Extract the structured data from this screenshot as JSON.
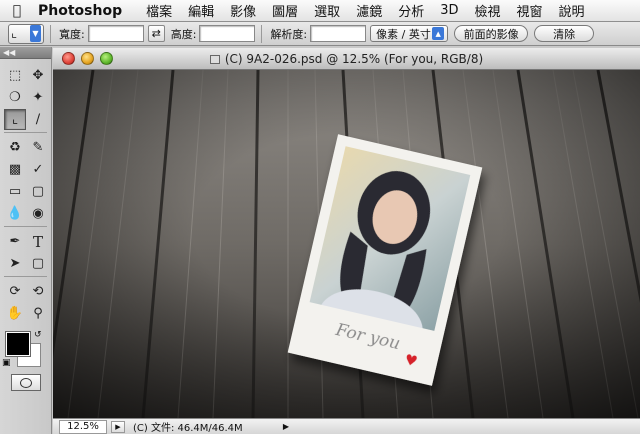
{
  "menubar": {
    "app_name": "Photoshop",
    "items": [
      "檔案",
      "編輯",
      "影像",
      "圖層",
      "選取",
      "濾鏡",
      "分析",
      "3D",
      "檢視",
      "視窗",
      "說明"
    ]
  },
  "options_bar": {
    "width_label": "寬度:",
    "height_label": "高度:",
    "resolution_label": "解析度:",
    "unit_select": "像素 / 英寸",
    "front_image_button": "前面的影像",
    "clear_button": "清除"
  },
  "document": {
    "title": "(C) 9A2-026.psd @ 12.5% (For you, RGB/8)",
    "zoom": "12.5%",
    "file_info": "(C) 文件: 46.4M/46.4M",
    "photo_caption": "For you"
  },
  "colors": {
    "foreground": "#000000",
    "background": "#ffffff",
    "accent": "#3b78d8"
  },
  "icons": {
    "tools": [
      "marquee",
      "move",
      "lasso",
      "quick-selection",
      "crop",
      "eyedropper",
      "spot-healing",
      "brush",
      "clone-stamp",
      "history-brush",
      "eraser",
      "gradient",
      "blur",
      "dodge",
      "pen",
      "type",
      "path-selection",
      "shape",
      "3d-rotate",
      "3d-orbit",
      "hand",
      "zoom"
    ]
  }
}
